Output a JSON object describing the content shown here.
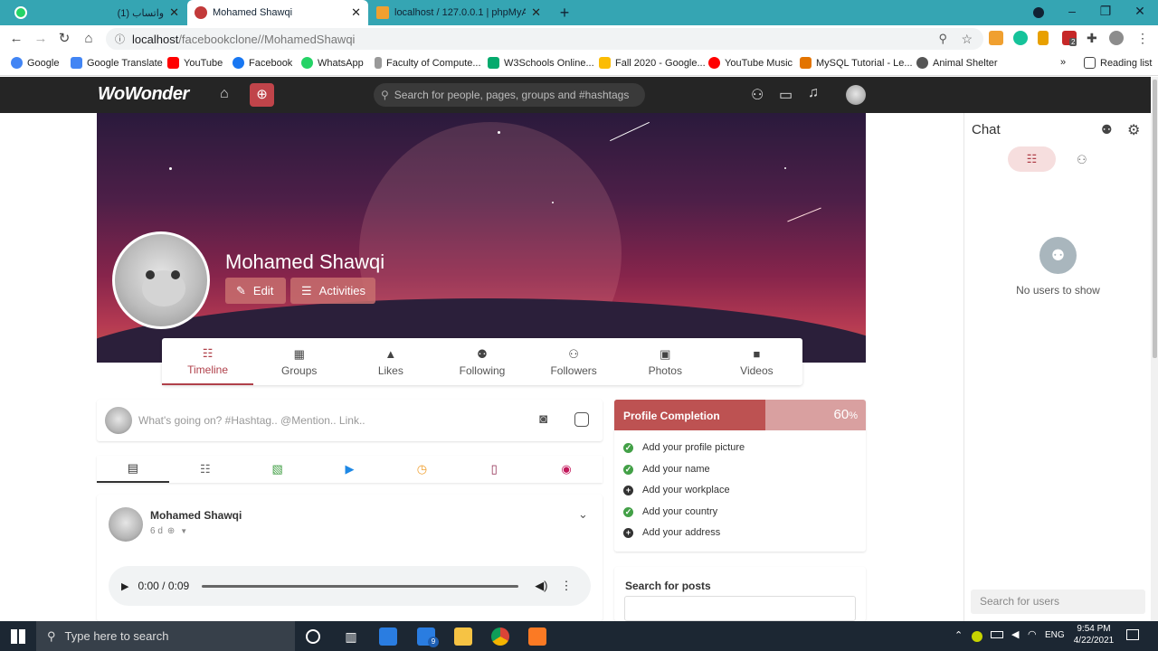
{
  "browser": {
    "tabs": [
      {
        "title": "(1) واتساب",
        "active": false
      },
      {
        "title": "Mohamed Shawqi",
        "active": true
      },
      {
        "title": "localhost / 127.0.0.1 | phpMyAdmin",
        "active": false
      }
    ],
    "url_host": "localhost",
    "url_path": "/facebookclone//MohamedShawqi",
    "bookmarks": [
      "Google",
      "Google Translate",
      "YouTube",
      "Facebook",
      "WhatsApp",
      "Faculty of Compute...",
      "W3Schools Online...",
      "Fall 2020 - Google...",
      "YouTube Music",
      "MySQL Tutorial - Le...",
      "Animal Shelter"
    ],
    "bookmarks_more": "»",
    "reading_list": "Reading list",
    "ext_badge": "2"
  },
  "site": {
    "logo": "WoWonder",
    "search_placeholder": "Search for people, pages, groups and #hashtags"
  },
  "profile": {
    "name": "Mohamed Shawqi",
    "edit_label": "Edit",
    "activities_label": "Activities",
    "tabs": [
      "Timeline",
      "Groups",
      "Likes",
      "Following",
      "Followers",
      "Photos",
      "Videos"
    ]
  },
  "publisher": {
    "placeholder": "What's going on? #Hashtag.. @Mention.. Link.."
  },
  "post": {
    "author": "Mohamed Shawqi",
    "time": "6 d",
    "audio_time": "0:00 / 0:09",
    "audio_progress": 0
  },
  "completion": {
    "title": "Profile Completion",
    "percent": "60",
    "percent_unit": "%",
    "items": [
      {
        "label": "Add your profile picture",
        "done": true
      },
      {
        "label": "Add your name",
        "done": true
      },
      {
        "label": "Add your workplace",
        "done": false
      },
      {
        "label": "Add your country",
        "done": true
      },
      {
        "label": "Add your address",
        "done": false
      }
    ]
  },
  "search_posts": {
    "title": "Search for posts"
  },
  "chat": {
    "title": "Chat",
    "empty_text": "No users to show",
    "search_placeholder": "Search for users"
  },
  "taskbar": {
    "search_placeholder": "Type here to search",
    "mail_badge": "9",
    "lang": "ENG",
    "time": "9:54 PM",
    "date": "4/22/2021"
  },
  "colors": {
    "accent": "#b0404a",
    "header": "#252525",
    "tabbar": "#35a5b3"
  }
}
